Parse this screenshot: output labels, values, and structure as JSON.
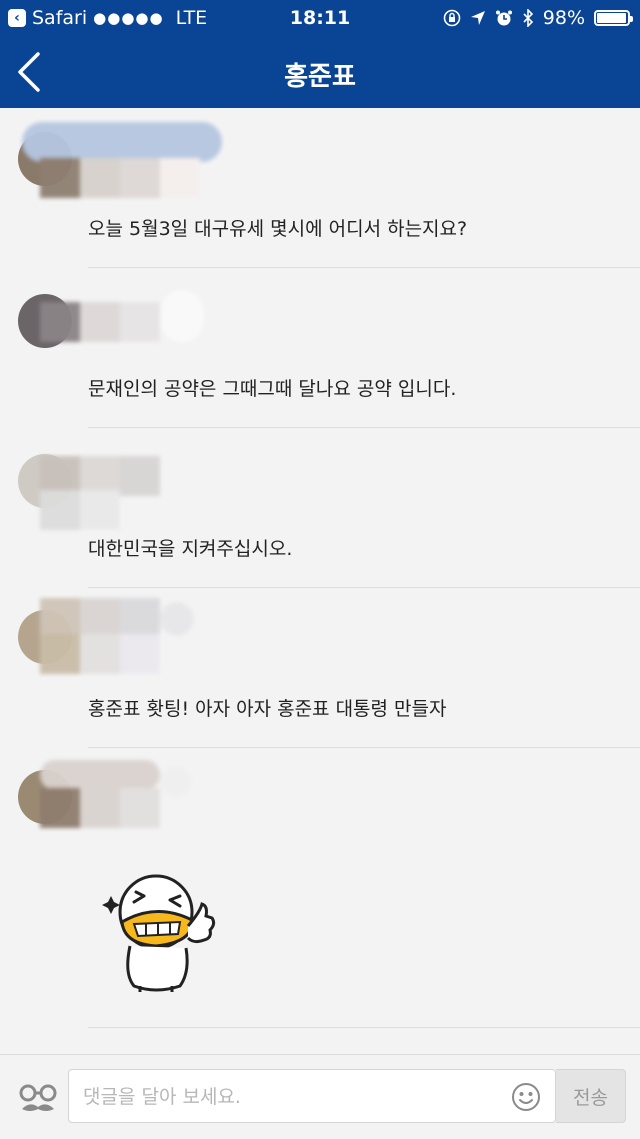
{
  "status_bar": {
    "back_app_label": "Safari",
    "signal": "●●●●●",
    "network": "LTE",
    "time": "18:11",
    "battery_percent": "98%",
    "icons": [
      "orientation-lock-icon",
      "location-arrow-icon",
      "alarm-icon",
      "bluetooth-icon",
      "battery-icon"
    ]
  },
  "nav": {
    "title": "홍준표",
    "back_icon": "chevron-left-icon"
  },
  "comments": [
    {
      "text": "오늘 5월3일 대구유세 몇시에 어디서 하는지요?"
    },
    {
      "text": "문재인의 공약은 그때그때 달나요 공약 입니다."
    },
    {
      "text": "대한민국을 지켜주십시오."
    },
    {
      "text": "홍준표 홧팅!  아자 아자   홍준표 대통령 만들자"
    },
    {
      "text": "",
      "sticker": "thumbs-up-character-sticker"
    }
  ],
  "input_bar": {
    "profile_icon": "glasses-mustache-icon",
    "placeholder": "댓글을 달아 보세요.",
    "value": "",
    "emoji_icon": "smiley-icon",
    "send_label": "전송"
  },
  "colors": {
    "header": "#0a4595",
    "background": "#f3f3f3",
    "text": "#222222",
    "send_button_bg": "#e4e4e4"
  }
}
